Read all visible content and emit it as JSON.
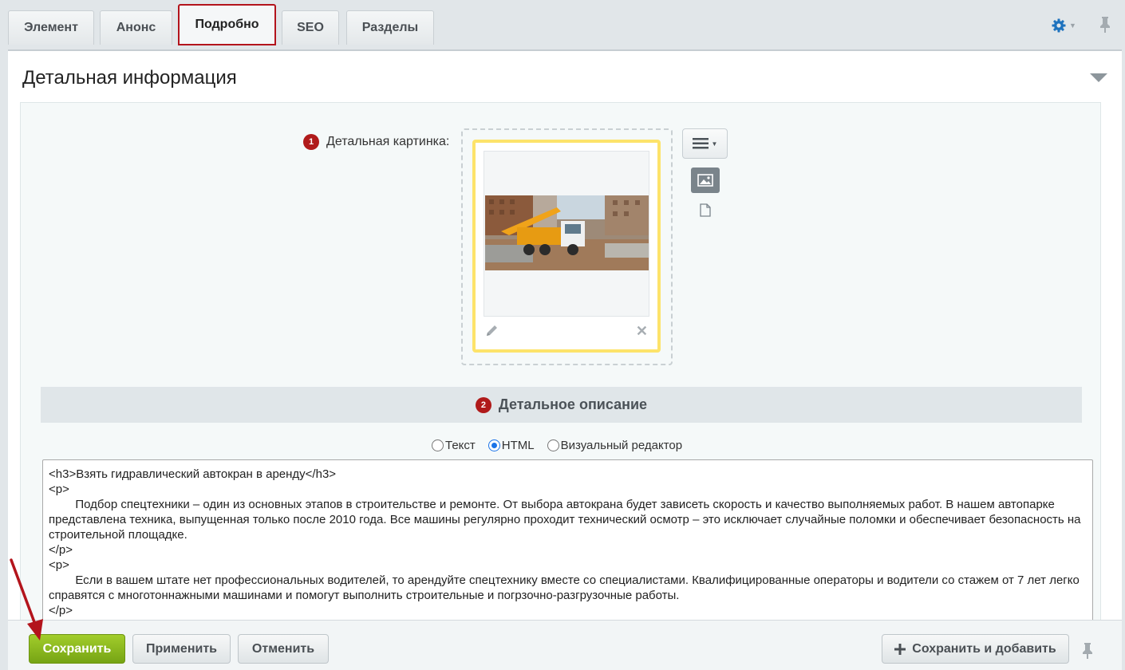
{
  "tabs": [
    {
      "label": "Элемент",
      "active": false
    },
    {
      "label": "Анонс",
      "active": false
    },
    {
      "label": "Подробно",
      "active": true
    },
    {
      "label": "SEO",
      "active": false
    },
    {
      "label": "Разделы",
      "active": false
    }
  ],
  "section": {
    "title": "Детальная информация"
  },
  "picture": {
    "badge": "1",
    "label": "Детальная картинка:"
  },
  "description": {
    "badge": "2",
    "title": "Детальное описание",
    "modes": [
      {
        "label": "Текст",
        "checked": false
      },
      {
        "label": "HTML",
        "checked": true
      },
      {
        "label": "Визуальный редактор",
        "checked": false
      }
    ],
    "content": [
      "<h3>Взять гидравлический автокран в аренду</h3>",
      "<p>",
      "        Подбор спецтехники – один из основных этапов в строительстве и ремонте. От выбора автокрана будет зависеть скорость и качество выполняемых работ. В нашем автопарке представлена техника, выпущенная только после 2010 года. Все машины регулярно проходит технический осмотр – это исключает случайные поломки и обеспечивает безопасность на строительной площадке.",
      "</p>",
      "<p>",
      "        Если в вашем штате нет профессиональных водителей, то арендуйте спецтехнику вместе со специалистами. Квалифицированные операторы и водители со стажем от 7 лет легко справятся с многотоннажными машинами и помогут выполнить строительные и погрзочно-разгрузочные работы.",
      "</p>"
    ]
  },
  "buttons": {
    "save": "Сохранить",
    "apply": "Применить",
    "cancel": "Отменить",
    "save_and_add": "Сохранить и добавить"
  },
  "colors": {
    "active_tab_border": "#b3141c",
    "badge": "#b01a1a",
    "save_button": "#8dbb1f",
    "annotation_arrow": "#b3141c"
  }
}
